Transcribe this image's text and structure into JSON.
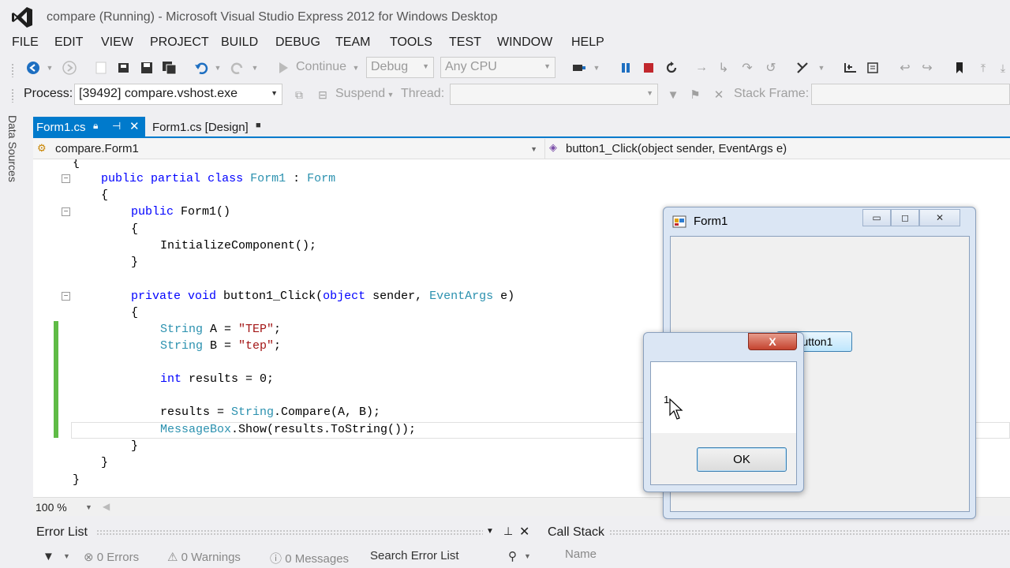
{
  "window": {
    "title": "compare (Running) - Microsoft Visual Studio Express 2012 for Windows Desktop"
  },
  "menu": [
    "FILE",
    "EDIT",
    "VIEW",
    "PROJECT",
    "BUILD",
    "DEBUG",
    "TEAM",
    "TOOLS",
    "TEST",
    "WINDOW",
    "HELP"
  ],
  "toolbar": {
    "continue_label": "Continue",
    "config_value": "Debug",
    "platform_value": "Any CPU"
  },
  "debug_location": {
    "process_label": "Process:",
    "process_value": "[39492] compare.vshost.exe",
    "suspend_label": "Suspend",
    "thread_label": "Thread:",
    "stack_frame_label": "Stack Frame:"
  },
  "side_tab": "Data Sources",
  "tabs": [
    {
      "label": "Form1.cs",
      "active": true
    },
    {
      "label": "Form1.cs [Design]",
      "active": false
    }
  ],
  "navbar": {
    "type": "compare.Form1",
    "member": "button1_Click(object sender, EventArgs e)"
  },
  "code": {
    "line_brace_top": "{",
    "line_class_kw1": "public",
    "line_class_kw2": "partial",
    "line_class_kw3": "class",
    "line_class_name": "Form1",
    "line_class_colon": " : ",
    "line_class_base": "Form",
    "open1": "{",
    "ctor_kw": "public",
    "ctor_name": " Form1()",
    "open2": "{",
    "init_call": "InitializeComponent();",
    "close2": "}",
    "method_kw1": "private",
    "method_kw2": "void",
    "method_name": " button1_Click(",
    "method_kw3": "object",
    "method_sender": " sender, ",
    "method_type": "EventArgs",
    "method_end": " e)",
    "open3": "{",
    "a_type": "String",
    "a_rest": " A = ",
    "a_val": "\"TEP\"",
    "a_semi": ";",
    "b_type": "String",
    "b_rest": " B = ",
    "b_val": "\"tep\"",
    "b_semi": ";",
    "int_kw": "int",
    "int_rest": " results = 0;",
    "cmp_start": "results = ",
    "cmp_type": "String",
    "cmp_rest": ".Compare(A, B);",
    "mb_type": "MessageBox",
    "mb_rest": ".Show(results.ToString());",
    "close3": "}",
    "close4": "}",
    "close5": "}"
  },
  "zoom": "100 %",
  "error_list": {
    "title": "Error List",
    "errors": "0 Errors",
    "warnings": "0 Warnings",
    "messages": "0 Messages",
    "search_placeholder": "Search Error List"
  },
  "call_stack": {
    "title": "Call Stack",
    "column_name": "Name"
  },
  "form1": {
    "title": "Form1",
    "button_label": "button1"
  },
  "messagebox": {
    "text": "1",
    "ok_label": "OK",
    "close_label": "X"
  },
  "colors": {
    "accent": "#007acc",
    "keyword": "#0000ff",
    "type": "#2b91af",
    "string": "#a31515",
    "change_bar": "#5fbb46"
  }
}
